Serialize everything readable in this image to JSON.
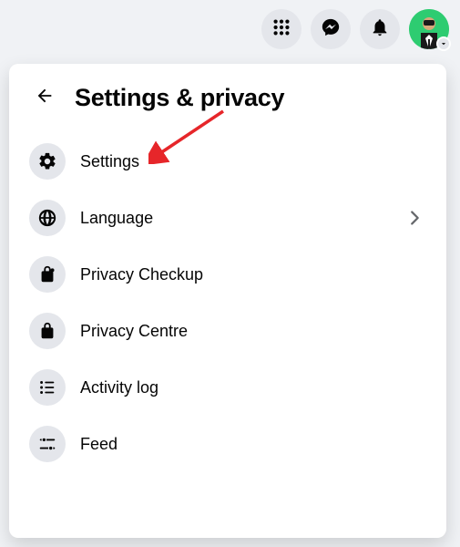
{
  "panel": {
    "title": "Settings & privacy"
  },
  "menu": {
    "items": [
      {
        "label": "Settings",
        "has_chevron": false
      },
      {
        "label": "Language",
        "has_chevron": true
      },
      {
        "label": "Privacy Checkup",
        "has_chevron": false
      },
      {
        "label": "Privacy Centre",
        "has_chevron": false
      },
      {
        "label": "Activity log",
        "has_chevron": false
      },
      {
        "label": "Feed",
        "has_chevron": false
      }
    ]
  },
  "annotation": {
    "arrow_color": "#e6262a"
  }
}
